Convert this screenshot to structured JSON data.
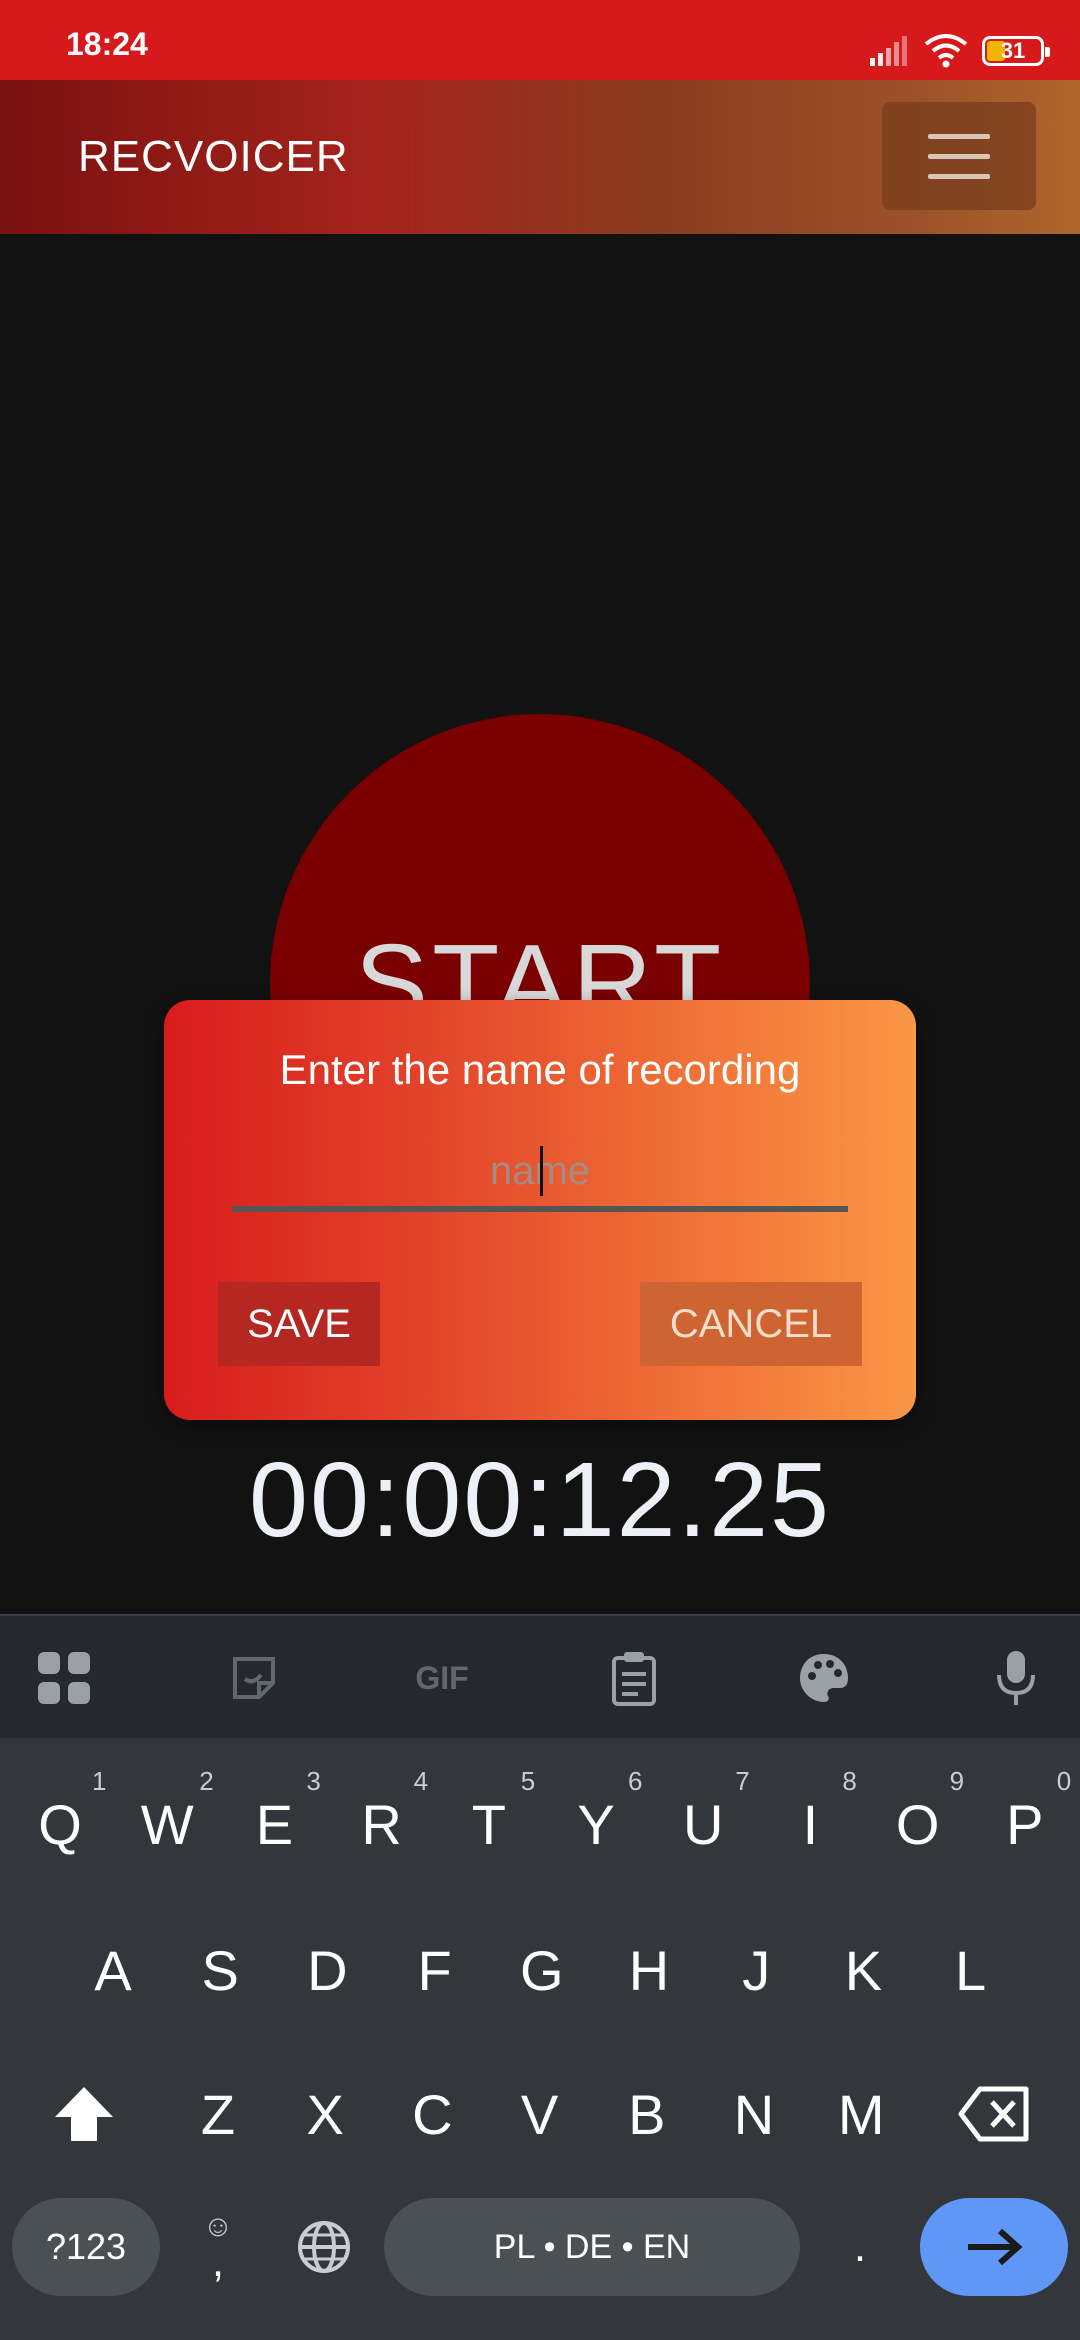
{
  "status": {
    "time": "18:24",
    "battery": "31"
  },
  "app": {
    "title": "RECVOICER",
    "menu_icon": "hamburger-menu-icon"
  },
  "recorder": {
    "start_label": "START",
    "timer": "00:00:12.25"
  },
  "dialog": {
    "title": "Enter the name of recording",
    "input_value": "",
    "input_placeholder": "name",
    "save_label": "SAVE",
    "cancel_label": "CANCEL"
  },
  "keyboard": {
    "toolbar": [
      "apps-grid-icon",
      "sticker-icon",
      "gif-icon",
      "clipboard-icon",
      "palette-icon",
      "mic-icon"
    ],
    "gif_label": "GIF",
    "row1": [
      "Q",
      "W",
      "E",
      "R",
      "T",
      "Y",
      "U",
      "I",
      "O",
      "P"
    ],
    "row1_hints": [
      "1",
      "2",
      "3",
      "4",
      "5",
      "6",
      "7",
      "8",
      "9",
      "0"
    ],
    "row2": [
      "A",
      "S",
      "D",
      "F",
      "G",
      "H",
      "J",
      "K",
      "L"
    ],
    "row3": [
      "Z",
      "X",
      "C",
      "V",
      "B",
      "N",
      "M"
    ],
    "symbols_label": "?123",
    "comma_label": ",",
    "period_label": ".",
    "space_label": "PL • DE • EN",
    "colors": {
      "enter": "#5e97f6",
      "dialog_start": "#d81c1c",
      "dialog_end": "#fb9746",
      "start_circle": "#7a0000"
    }
  }
}
